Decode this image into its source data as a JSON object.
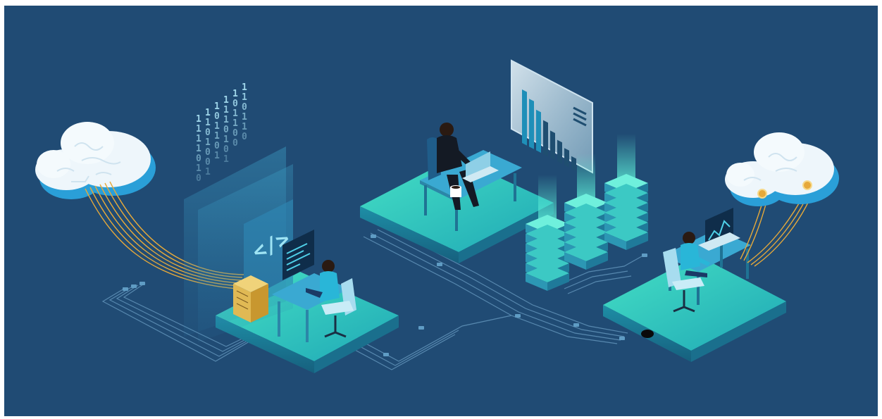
{
  "scene": {
    "description_items": [
      "cloud-left",
      "developer-workstation",
      "manager-workstation",
      "server-racks",
      "analyst-workstation",
      "cloud-right",
      "dashboard-panel"
    ],
    "binary_columns": [
      [
        "1",
        "1",
        "1",
        "1",
        "0",
        "1",
        "0"
      ],
      [
        "1",
        "1",
        "0",
        "1",
        "0",
        "0",
        "1"
      ],
      [
        "1",
        "0",
        "1",
        "1",
        "0",
        "1"
      ],
      [
        "1",
        "1",
        "1",
        "0",
        "1",
        "0",
        "1"
      ],
      [
        "1",
        "0",
        "1",
        "1",
        "0",
        "0"
      ],
      [
        "1",
        "1",
        "0",
        "1",
        "1",
        "0"
      ]
    ],
    "code_glyph": "</>",
    "chart_bars": [
      0.95,
      0.85,
      0.72,
      0.6,
      0.48,
      0.38,
      0.3,
      0.22
    ],
    "colors": {
      "background": "#204b74",
      "platform_top": "#34c8b8",
      "platform_side": "#1b7f96",
      "cloud": "#eef6fb",
      "cloud_edge": "#2a9fd8",
      "cable": "#e6a93a",
      "circuit": "#6fa3c8"
    }
  }
}
